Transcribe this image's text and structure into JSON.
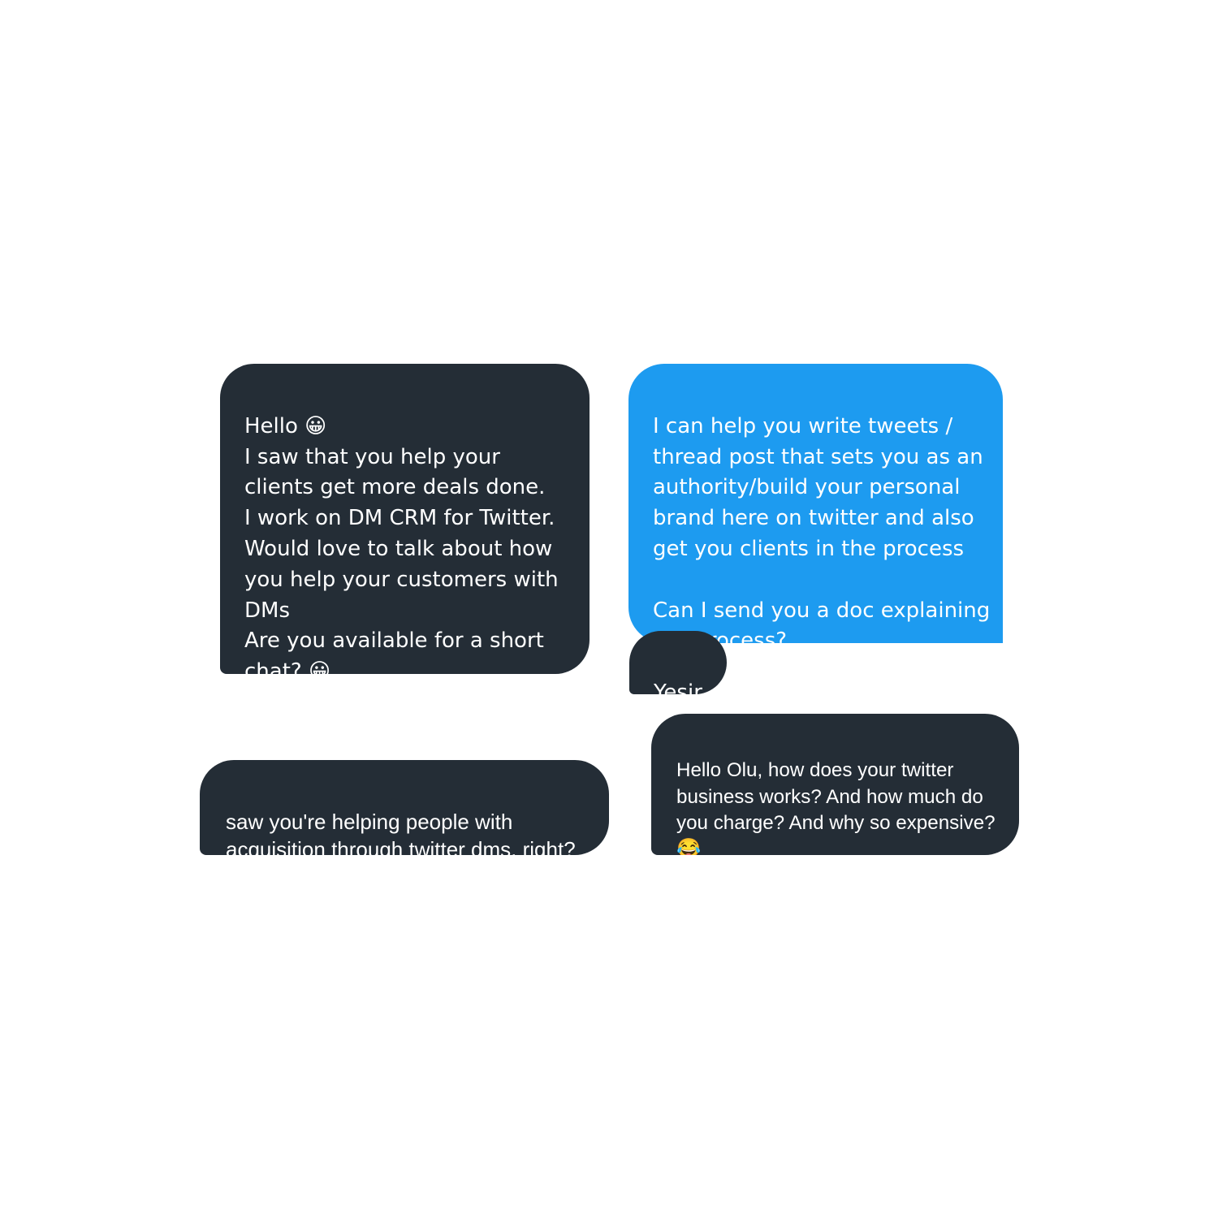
{
  "conversation": {
    "messages": [
      {
        "direction": "received",
        "text": "Hello 😀\nI saw that you help your clients get more deals done.\nI work on DM CRM for Twitter.\nWould love to talk about how you help your customers with DMs\nAre you available for a short chat? 😀"
      },
      {
        "direction": "sent",
        "text": "I can help you write tweets / thread post that sets you as an authority/build your personal brand here on twitter  and also get you clients in the process\n\nCan I send you a doc explaining our process?"
      },
      {
        "direction": "received",
        "text": "Yesir"
      },
      {
        "direction": "received",
        "text": "Hello Olu, how does your twitter business works? And how much do you charge? And why so expensive? 😂"
      },
      {
        "direction": "received",
        "text": "saw you're helping people with acquisition through twitter dms, right?"
      }
    ]
  },
  "colors": {
    "received_bubble": "#242d36",
    "sent_bubble": "#1d9bf0",
    "text": "#ffffff",
    "background": "#ffffff"
  }
}
